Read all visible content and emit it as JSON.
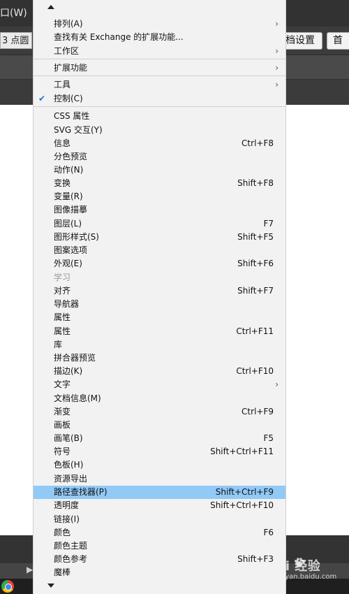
{
  "menubar": {
    "window_menu_label": "口(W)"
  },
  "controlbar": {
    "left_field_text": "3 点圆",
    "document_setup_label": "档设置",
    "preferences_label": "首"
  },
  "watermark": {
    "brand": "Bai 经验",
    "url": "jingyan.baidu.com"
  },
  "menu": {
    "items": [
      {
        "label": "排列(A)",
        "submenu": true
      },
      {
        "label": "查找有关 Exchange 的扩展功能..."
      },
      {
        "label": "工作区",
        "submenu": true
      },
      {
        "label": "扩展功能",
        "submenu": true
      },
      {
        "label": "工具",
        "submenu": true
      },
      {
        "label": "控制(C)",
        "checked": true
      },
      {
        "label": "CSS 属性"
      },
      {
        "label": "SVG 交互(Y)"
      },
      {
        "label": "信息",
        "shortcut": "Ctrl+F8"
      },
      {
        "label": "分色预览"
      },
      {
        "label": "动作(N)"
      },
      {
        "label": "变换",
        "shortcut": "Shift+F8"
      },
      {
        "label": "变量(R)"
      },
      {
        "label": "图像描摹"
      },
      {
        "label": "图层(L)",
        "shortcut": "F7"
      },
      {
        "label": "图形样式(S)",
        "shortcut": "Shift+F5"
      },
      {
        "label": "图案选项"
      },
      {
        "label": "外观(E)",
        "shortcut": "Shift+F6"
      },
      {
        "label": "学习",
        "disabled": true
      },
      {
        "label": "对齐",
        "shortcut": "Shift+F7"
      },
      {
        "label": "导航器"
      },
      {
        "label": "属性"
      },
      {
        "label": "属性",
        "shortcut": "Ctrl+F11"
      },
      {
        "label": "库"
      },
      {
        "label": "拼合器预览"
      },
      {
        "label": "描边(K)",
        "shortcut": "Ctrl+F10"
      },
      {
        "label": "文字",
        "submenu": true
      },
      {
        "label": "文档信息(M)"
      },
      {
        "label": "渐变",
        "shortcut": "Ctrl+F9"
      },
      {
        "label": "画板"
      },
      {
        "label": "画笔(B)",
        "shortcut": "F5"
      },
      {
        "label": "符号",
        "shortcut": "Shift+Ctrl+F11"
      },
      {
        "label": "色板(H)"
      },
      {
        "label": "资源导出"
      },
      {
        "label": "路径查找器(P)",
        "shortcut": "Shift+Ctrl+F9",
        "highlighted": true
      },
      {
        "label": "透明度",
        "shortcut": "Shift+Ctrl+F10"
      },
      {
        "label": "链接(I)"
      },
      {
        "label": "颜色",
        "shortcut": "F6"
      },
      {
        "label": "颜色主题"
      },
      {
        "label": "颜色参考",
        "shortcut": "Shift+F3"
      },
      {
        "label": "魔棒"
      }
    ],
    "submenu_glyph": "›",
    "check_glyph": "✔"
  },
  "colors": {
    "menu_background": "#f2f2f2",
    "highlight": "#91c9f7",
    "check_color": "#1e73d2"
  }
}
